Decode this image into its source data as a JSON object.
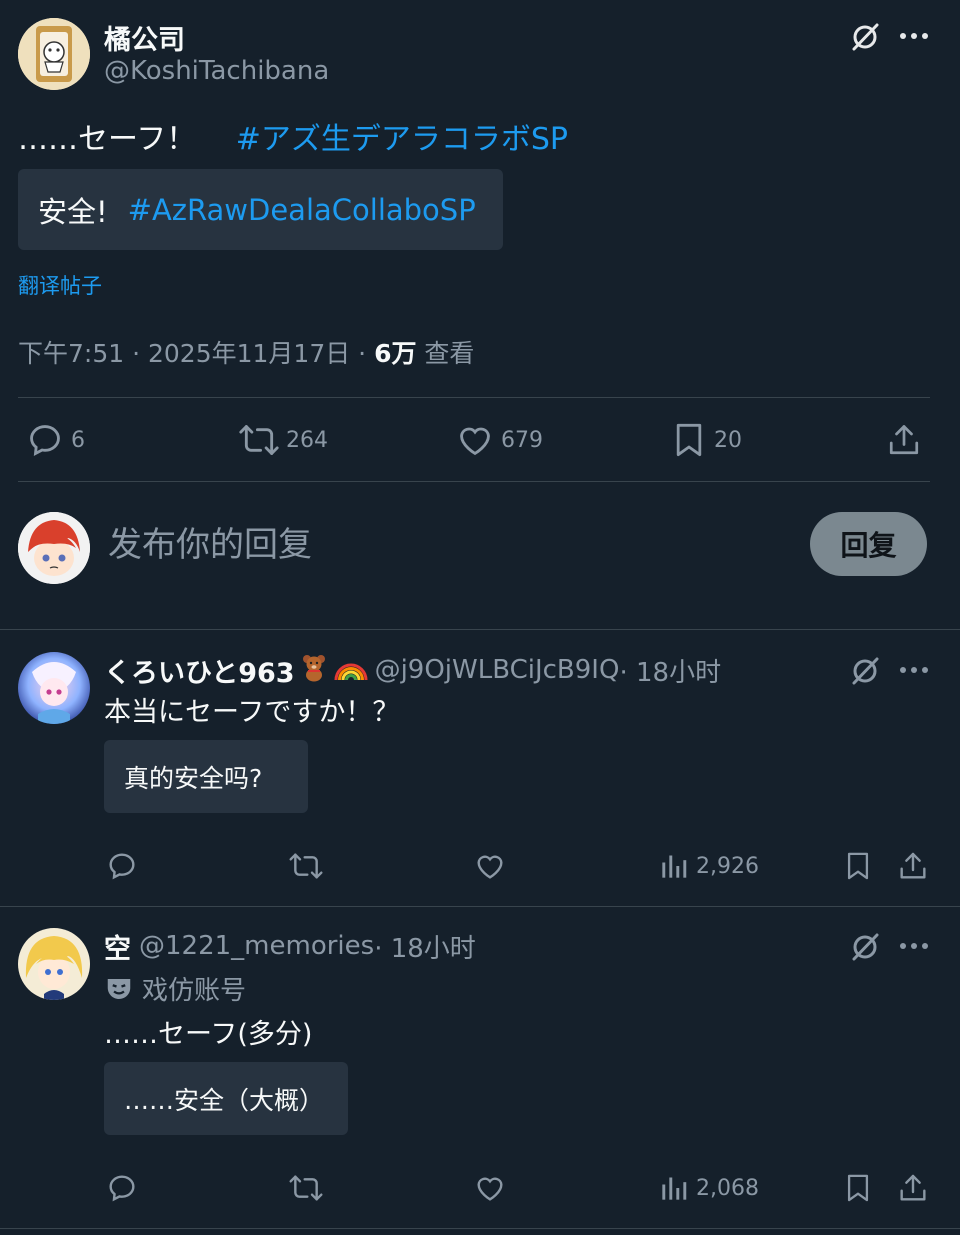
{
  "main_post": {
    "author_name": "橘公司",
    "author_handle": "@KoshiTachibana",
    "text": "……セーフ！",
    "hashtag": "#アズ生デアラコラボSP",
    "translation_text": "安全!",
    "translation_hashtag": "#AzRawDealaCollaboSP",
    "translate_label": "翻译帖子",
    "time": "下午7:51 · 2025年11月17日 · ",
    "views_count": "6万",
    "views_label": " 查看",
    "stats": {
      "replies": "6",
      "reposts": "264",
      "likes": "679",
      "bookmarks": "20"
    }
  },
  "composer": {
    "placeholder": "发布你的回复",
    "button_label": "回复"
  },
  "replies": [
    {
      "author_name": "くろいひと963",
      "author_handle": "@j9OjWLBCiJcB9IQ",
      "time": " · 18小时",
      "text": "本当にセーフですか！？",
      "translation": "真的安全吗?",
      "views": "2,926"
    },
    {
      "author_name": "空",
      "author_handle": "@1221_memories",
      "time": " · 18小时",
      "parody_label": "戏仿账号",
      "text": "……セーフ(多分)",
      "translation": "……安全（大概）",
      "views": "2,068"
    }
  ],
  "colors": {
    "background": "#15202b",
    "accent": "#1d9bf0",
    "muted": "#8b98a5",
    "divider": "#38444d"
  }
}
